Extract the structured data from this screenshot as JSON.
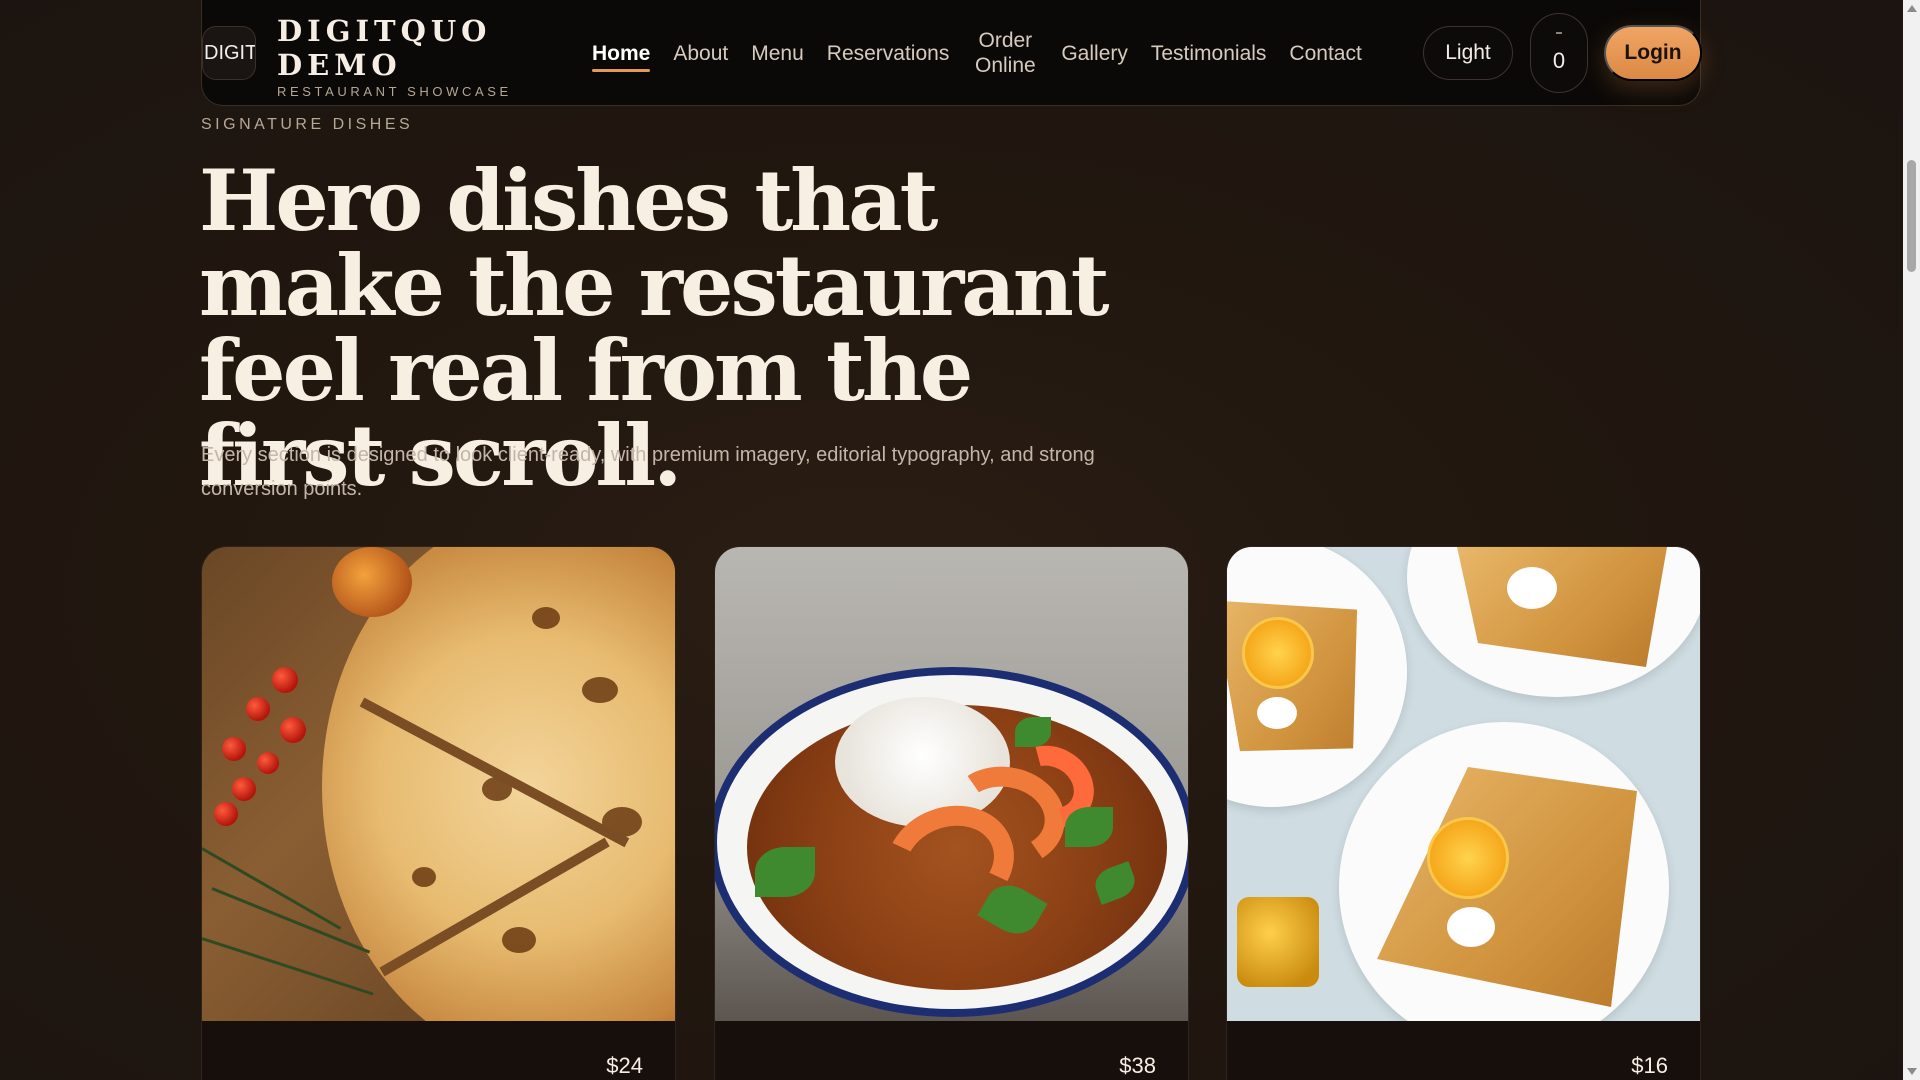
{
  "brand": {
    "logo_alt": "DIGITQUO",
    "title_line1": "DIGITQUO",
    "title_line2": "DEMO",
    "subtitle": "RESTAURANT SHOWCASE"
  },
  "nav": {
    "items": [
      {
        "label": "Home",
        "active": true
      },
      {
        "label": "About"
      },
      {
        "label": "Menu"
      },
      {
        "label": "Reservations"
      },
      {
        "label": "Order Online"
      },
      {
        "label": "Gallery"
      },
      {
        "label": "Testimonials"
      },
      {
        "label": "Contact"
      }
    ],
    "theme_toggle": "Light",
    "cart_count": "0",
    "login": "Login"
  },
  "hero": {
    "eyebrow": "SIGNATURE DISHES",
    "title": "Hero dishes that make the restaurant feel real from the first scroll.",
    "description": "Every section is designed to look client-ready, with premium imagery, editorial typography, and strong conversion points."
  },
  "dishes": [
    {
      "image": "pizza",
      "price": "$24"
    },
    {
      "image": "shrimp-gumbo",
      "price": "$38"
    },
    {
      "image": "orange-crepes",
      "price": "$16"
    }
  ],
  "colors": {
    "accent": "#e49a57",
    "background": "#1f1712",
    "header": "#0b0907"
  }
}
